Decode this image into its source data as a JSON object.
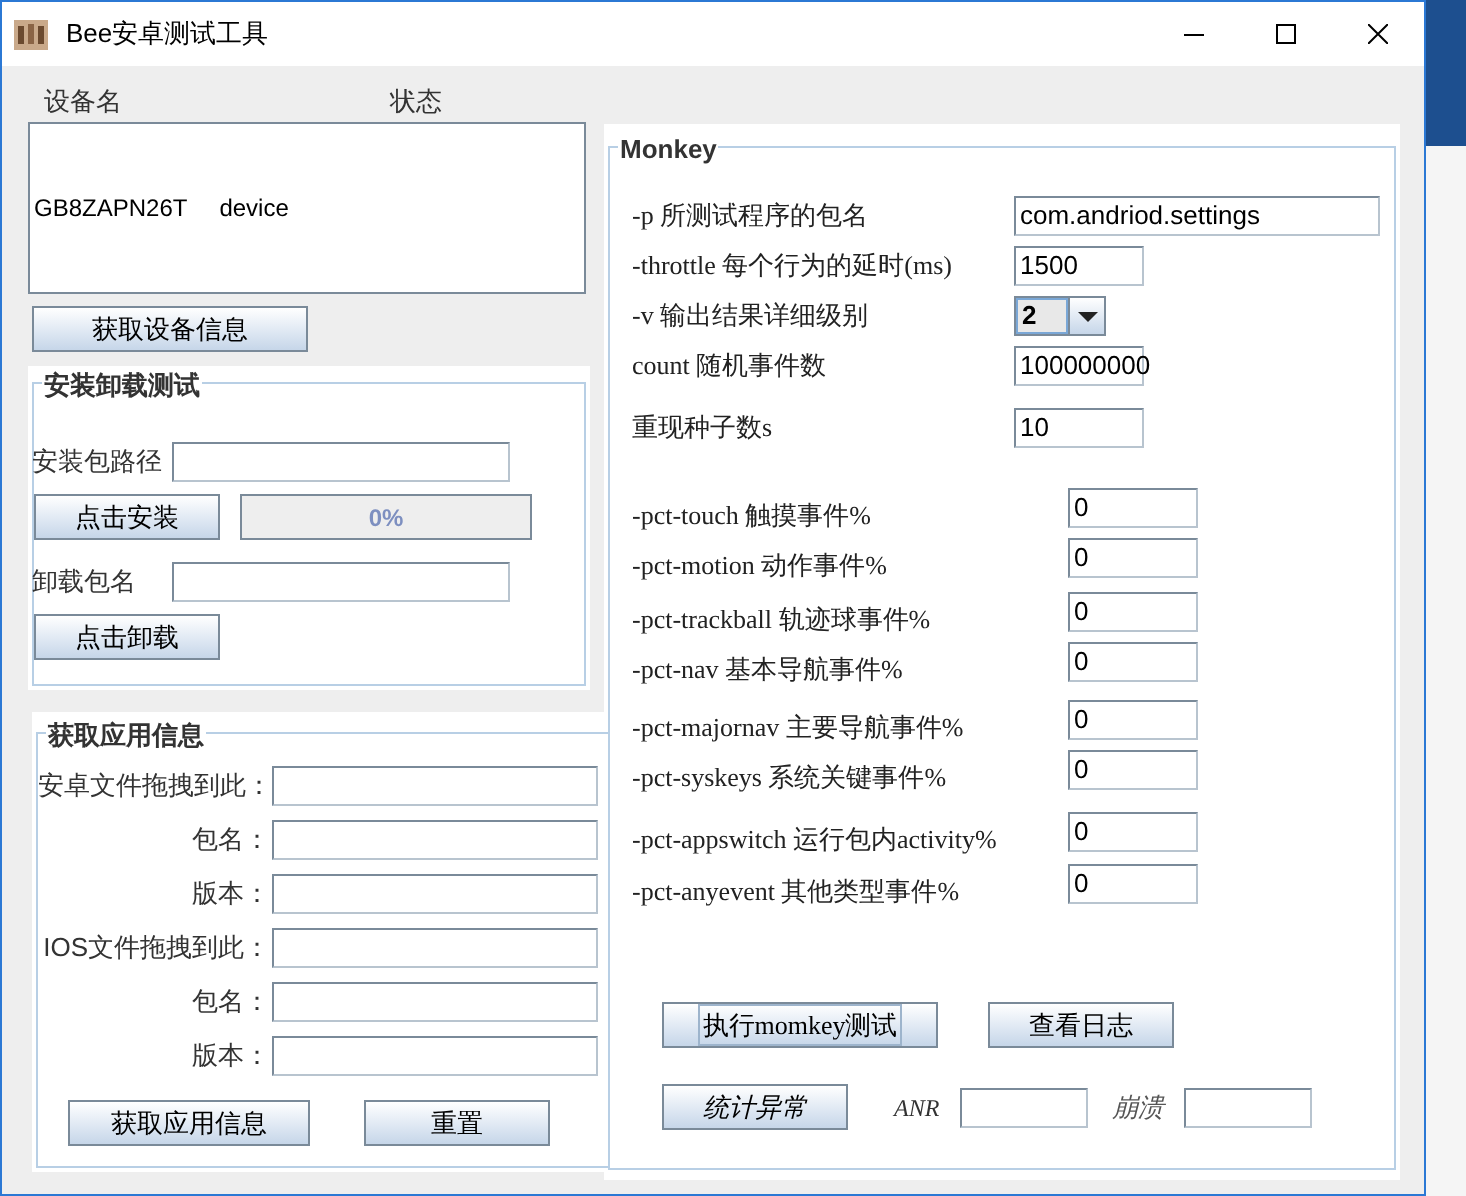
{
  "window": {
    "title": "Bee安卓测试工具"
  },
  "device_list": {
    "columns": [
      "设备名",
      "状态"
    ],
    "rows": [
      {
        "name": "GB8ZAPN26T",
        "state": "device"
      }
    ]
  },
  "device_button": "获取设备信息",
  "install_group": {
    "title": "安装卸载测试",
    "path_label": "安装包路径",
    "install_button": "点击安装",
    "progress": {
      "level": 0,
      "reading": "0%"
    },
    "uninstall_label": "卸载包名",
    "uninstall_button": "点击卸载"
  },
  "app_info_group": {
    "title": "获取应用信息",
    "fields": [
      {
        "label": "安卓文件拖拽到此："
      },
      {
        "label": "包名："
      },
      {
        "label": "版本："
      },
      {
        "label": "IOS文件拖拽到此："
      },
      {
        "label": "包名："
      },
      {
        "label": "版本："
      }
    ],
    "buttons": [
      "获取应用信息",
      "重置"
    ]
  },
  "monkey": {
    "title": "Monkey",
    "params": [
      {
        "kind": "wide",
        "label": "-p 所测试程序的包名",
        "value": "com.andriod.settings"
      },
      {
        "kind": "narrow",
        "label": "-throttle 每个行为的延时(ms)",
        "value": "1500"
      },
      {
        "kind": "combo",
        "label": "-v 输出结果详细级别",
        "value": "2"
      },
      {
        "kind": "narrow",
        "label": "count 随机事件数",
        "value": "100000000"
      },
      {
        "kind": "narrow",
        "label": "重现种子数s",
        "value": "10"
      }
    ],
    "pct": [
      {
        "label": "-pct-touch 触摸事件%",
        "value": "0"
      },
      {
        "label": "-pct-motion 动作事件%",
        "value": "0"
      },
      {
        "label": "-pct-trackball 轨迹球事件%",
        "value": "0"
      },
      {
        "label": "-pct-nav 基本导航事件%",
        "value": "0"
      },
      {
        "label": "-pct-majornav 主要导航事件%",
        "value": "0"
      },
      {
        "label": "-pct-syskeys 系统关键事件%",
        "value": "0"
      },
      {
        "label": "-pct-appswitch 运行包内activity%",
        "value": "0"
      },
      {
        "label": "-pct-anyevent 其他类型事件%",
        "value": "0"
      }
    ],
    "run_button": {
      "label": "执行momkey测试",
      "focused": true
    },
    "log_button": "查看日志",
    "stats_button": "统计异常",
    "anr_label": "ANR",
    "crash_label": "崩溃"
  }
}
